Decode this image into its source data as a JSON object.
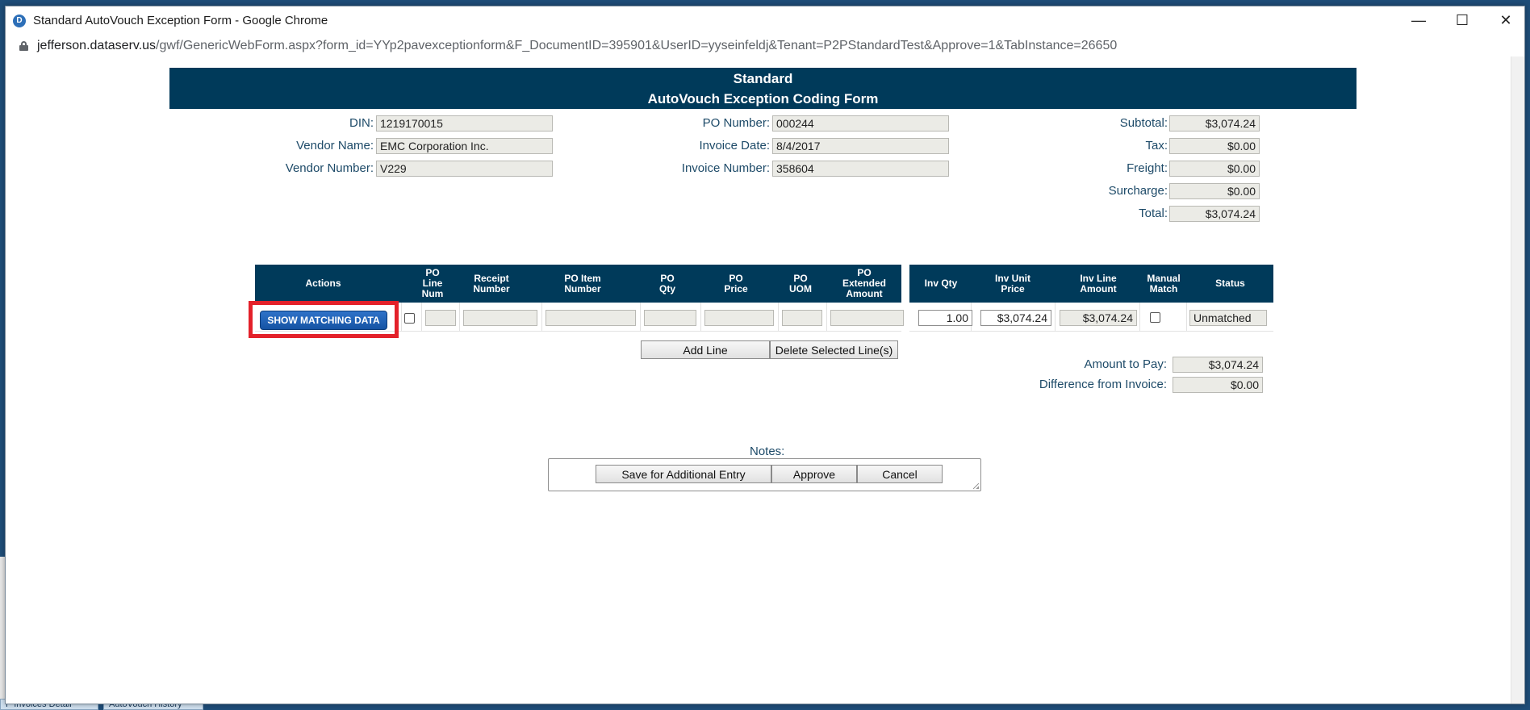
{
  "background": {
    "tabs": [
      "P Invoices Detail",
      "AutoVouch History"
    ]
  },
  "window": {
    "title": "Standard AutoVouch Exception Form - Google Chrome",
    "app_icon": "D",
    "url_host": "jefferson.dataserv.us",
    "url_path": "/gwf/GenericWebForm.aspx?form_id=YYp2pavexceptionform&F_DocumentID=395901&UserID=yyseinfeldj&Tenant=P2PStandardTest&Approve=1&TabInstance=26650",
    "controls": {
      "minimize": "—",
      "maximize": "☐",
      "close": "✕"
    }
  },
  "form": {
    "header_line1": "Standard",
    "header_line2": "AutoVouch Exception Coding Form",
    "fields": {
      "din": {
        "label": "DIN:",
        "value": "1219170015"
      },
      "vendor_name": {
        "label": "Vendor Name:",
        "value": "EMC Corporation Inc."
      },
      "vendor_number": {
        "label": "Vendor Number:",
        "value": "V229"
      },
      "po_number": {
        "label": "PO Number:",
        "value": "000244"
      },
      "invoice_date": {
        "label": "Invoice Date:",
        "value": "8/4/2017"
      },
      "invoice_number": {
        "label": "Invoice Number:",
        "value": "358604"
      },
      "subtotal": {
        "label": "Subtotal:",
        "value": "$3,074.24"
      },
      "tax": {
        "label": "Tax:",
        "value": "$0.00"
      },
      "freight": {
        "label": "Freight:",
        "value": "$0.00"
      },
      "surcharge": {
        "label": "Surcharge:",
        "value": "$0.00"
      },
      "total": {
        "label": "Total:",
        "value": "$3,074.24"
      }
    },
    "grid": {
      "headers": {
        "actions": "Actions",
        "po_line_num": [
          "PO",
          "Line",
          "Num"
        ],
        "receipt_number": [
          "Receipt",
          "Number"
        ],
        "po_item_number": [
          "PO Item",
          "Number"
        ],
        "po_qty": [
          "PO",
          "Qty"
        ],
        "po_price": [
          "PO",
          "Price"
        ],
        "po_uom": [
          "PO",
          "UOM"
        ],
        "po_extended_amount": [
          "PO",
          "Extended",
          "Amount"
        ],
        "inv_qty": "Inv Qty",
        "inv_unit_price": [
          "Inv Unit",
          "Price"
        ],
        "inv_line_amount": [
          "Inv Line",
          "Amount"
        ],
        "manual_match": [
          "Manual",
          "Match"
        ],
        "status": "Status"
      },
      "row": {
        "show_matching_label": "SHOW MATCHING DATA",
        "inv_qty": "1.00",
        "inv_unit_price": "$3,074.24",
        "inv_line_amount": "$3,074.24",
        "status": "Unmatched"
      }
    },
    "add_line_label": "Add Line",
    "delete_lines_label": "Delete Selected Line(s)",
    "amount_to_pay": {
      "label": "Amount to Pay:",
      "value": "$3,074.24"
    },
    "difference": {
      "label": "Difference from Invoice:",
      "value": "$0.00"
    },
    "notes_label": "Notes:",
    "buttons": {
      "save": "Save for Additional Entry",
      "approve": "Approve",
      "cancel": "Cancel"
    },
    "colors": {
      "header_bg": "#003a5a",
      "label_text": "#1d4a68",
      "highlight_box": "#e3212a",
      "primary_button": "#1f63b5"
    }
  }
}
